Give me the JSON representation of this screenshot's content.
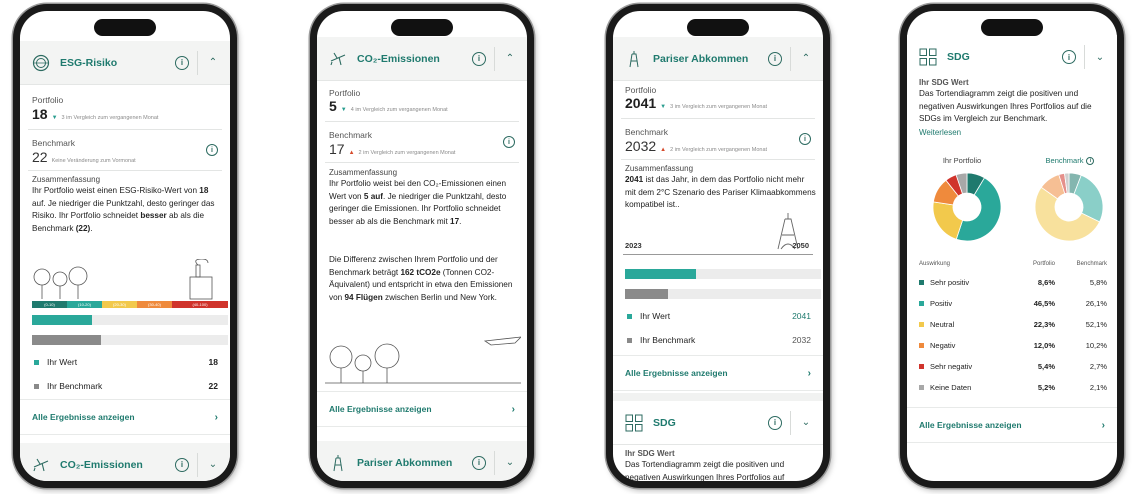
{
  "colors": {
    "teal": "#2aa89a",
    "gray": "#8a8a8a",
    "accent": "#1f7a6e",
    "header_bg": "#f3f4f3"
  },
  "phone1": {
    "header": {
      "title": "ESG-Risiko",
      "icon": "globe-icon"
    },
    "portfolio_label": "Portfolio",
    "portfolio_value": "18",
    "portfolio_compare": "3 im Vergleich zum vergangenen Monat",
    "benchmark_label": "Benchmark",
    "benchmark_value": "22",
    "benchmark_compare": "Keine Veränderung zum Vormonat",
    "summary_label": "Zusammenfassung",
    "summary_parts": {
      "a": "Ihr Portfolio weist einen ESG-Risiko-Wert von ",
      "b": "18",
      "c": " auf. Je niedriger die Punktzahl, desto geringer das Risiko. Ihr Portfolio schneidet ",
      "d": "besser",
      "e": " ab als die Benchmark ",
      "f": "(22)",
      "g": "."
    },
    "scale_labels": [
      "(0-10)",
      "(10-20)",
      "(20-30)",
      "(30-40)",
      "(40-100)"
    ],
    "scale_colors": [
      "#1f7a6e",
      "#2aa89a",
      "#f2c94c",
      "#ef8a3c",
      "#d0342c"
    ],
    "bars": {
      "ihr_wert": 0.18,
      "benchmark": 0.22
    },
    "legend": [
      {
        "label": "Ihr Wert",
        "value": "18"
      },
      {
        "label": "Ihr Benchmark",
        "value": "22"
      }
    ],
    "cta": "Alle Ergebnisse anzeigen",
    "next_header": {
      "title": "CO₂-Emissionen",
      "icon": "plane-icon"
    }
  },
  "phone2": {
    "header": {
      "title": "CO₂-Emissionen",
      "icon": "plane-icon"
    },
    "portfolio_label": "Portfolio",
    "portfolio_value": "5",
    "portfolio_compare": "4 im Vergleich zum vergangenen Monat",
    "benchmark_label": "Benchmark",
    "benchmark_value": "17",
    "benchmark_compare": "2 im Vergleich zum vergangenen Monat",
    "summary_label": "Zusammenfassung",
    "summary_parts": {
      "a": "Ihr Portfolio weist bei den CO₂-Emissionen einen Wert von ",
      "b": "5 auf",
      "c": ". Je niedriger die Punktzahl, desto geringer die Emissionen. Ihr Portfolio schneidet besser ab als die Benchmark mit ",
      "d": "17",
      "e": "."
    },
    "summary2_parts": {
      "a": "Die Differenz zwischen Ihrem Portfolio und der Benchmark beträgt ",
      "b": "162 tCO2e",
      "c": " (Tonnen CO2-Äquivalent) und entspricht in etwa den Emissionen von ",
      "d": "94 Flügen",
      "e": " zwischen Berlin und New York."
    },
    "cta": "Alle Ergebnisse anzeigen",
    "next_header": {
      "title": "Pariser Abkommen",
      "icon": "eiffel-tower-icon"
    }
  },
  "phone3": {
    "header": {
      "title": "Pariser Abkommen",
      "icon": "eiffel-tower-icon"
    },
    "portfolio_label": "Portfolio",
    "portfolio_value": "2041",
    "portfolio_compare": "3 im Vergleich zum vergangenen Monat",
    "benchmark_label": "Benchmark",
    "benchmark_value": "2032",
    "benchmark_compare": "2 im Vergleich zum vergangenen Monat",
    "summary_label": "Zusammenfassung",
    "summary_parts": {
      "a": "2041",
      "b": " ist das Jahr, in dem das Portfolio nicht mehr mit dem 2°C Szenario des Pariser Klimaabkommens kompatibel ist.."
    },
    "timeline": {
      "start": "2023",
      "end": "2050"
    },
    "bars": {
      "ihr_wert": 0.36,
      "benchmark": 0.22
    },
    "legend": [
      {
        "label": "Ihr Wert",
        "value": "2041"
      },
      {
        "label": "Ihr Benchmark",
        "value": "2032"
      }
    ],
    "cta": "Alle Ergebnisse anzeigen",
    "next_header": {
      "title": "SDG",
      "icon": "grid-icon"
    },
    "sdg_label": "Ihr SDG Wert",
    "sdg_text": "Das Tortendiagramm zeigt die positiven und negativen Auswirkungen Ihres Portfolios auf"
  },
  "phone4": {
    "header": {
      "title": "SDG",
      "icon": "grid-icon"
    },
    "sdg_label": "Ihr SDG Wert",
    "sdg_text": "Das Tortendiagramm zeigt die positiven und negativen Auswirkungen Ihres Portfolios auf die SDGs im Vergleich zur Benchmark.",
    "read_more": "Weiterlesen",
    "pie_portfolio_label": "Ihr Portfolio",
    "pie_benchmark_label": "Benchmark",
    "table_header": {
      "name": "Auswirkung",
      "portfolio": "Portfolio",
      "benchmark": "Benchmark"
    },
    "rows": [
      {
        "name": "Sehr positiv",
        "portfolio": "8,6%",
        "benchmark": "5,8%",
        "color": "#1f7a6e",
        "p": 8.6,
        "b": 5.8
      },
      {
        "name": "Positiv",
        "portfolio": "46,5%",
        "benchmark": "26,1%",
        "color": "#2aa89a",
        "p": 46.5,
        "b": 26.1
      },
      {
        "name": "Neutral",
        "portfolio": "22,3%",
        "benchmark": "52,1%",
        "color": "#f2c94c",
        "p": 22.3,
        "b": 52.1
      },
      {
        "name": "Negativ",
        "portfolio": "12,0%",
        "benchmark": "10,2%",
        "color": "#ef8a3c",
        "p": 12.0,
        "b": 10.2
      },
      {
        "name": "Sehr negativ",
        "portfolio": "5,4%",
        "benchmark": "2,7%",
        "color": "#d0342c",
        "p": 5.4,
        "b": 2.7
      },
      {
        "name": "Keine Daten",
        "portfolio": "5,2%",
        "benchmark": "2,1%",
        "color": "#a8a8a8",
        "p": 5.2,
        "b": 2.1
      }
    ],
    "cta": "Alle Ergebnisse anzeigen"
  }
}
